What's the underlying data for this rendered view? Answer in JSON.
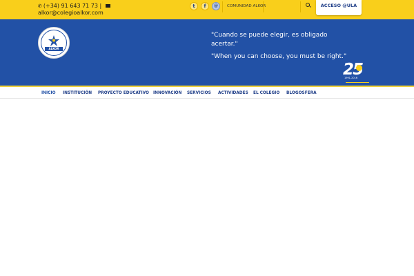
{
  "topbar": {
    "phone": "(+34) 91 643 71 73 |",
    "email": "alkor@colegioalkor.com",
    "comunidad": "COMUNIDAD ALKOR",
    "access_label": "ACCESO @ULA",
    "social": {
      "twitter": "t",
      "facebook": "f",
      "comunidad_icon": "@"
    }
  },
  "header": {
    "quote_es": "\"Cuando se puede elegir, es obligado acertar.\"",
    "quote_en": "\"When you can choose, you must be right.\"",
    "logo_name": "ALKOR",
    "badge_number": "25",
    "badge_years": "1991-2016"
  },
  "nav": {
    "items": [
      {
        "label": "Inicio"
      },
      {
        "label": "Institución"
      },
      {
        "label": "Proyecto educativo"
      },
      {
        "label": "Innovación"
      },
      {
        "label": "Servicios"
      },
      {
        "label": "Actividades"
      },
      {
        "label": "El colegio"
      },
      {
        "label": "Blogosfera"
      }
    ]
  },
  "colors": {
    "topbar": "#f9cf1b",
    "header": "#2251a6",
    "nav_text": "#1f3e88"
  },
  "icons": {
    "phone": "phone-icon",
    "email": "envelope-icon",
    "twitter": "twitter-icon",
    "facebook": "facebook-icon",
    "search": "search-icon"
  }
}
